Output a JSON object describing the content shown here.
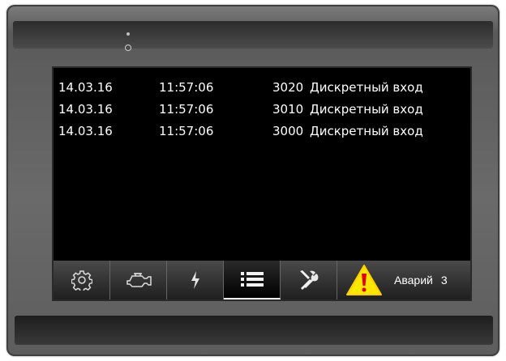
{
  "events": [
    {
      "date": "14.03.16",
      "time": "11:57:06",
      "code": "3020",
      "description": "Дискретный вход"
    },
    {
      "date": "14.03.16",
      "time": "11:57:06",
      "code": "3010",
      "description": "Дискретный вход"
    },
    {
      "date": "14.03.16",
      "time": "11:57:06",
      "code": "3000",
      "description": "Дискретный вход"
    }
  ],
  "navbar": {
    "items": [
      {
        "icon": "gear-icon"
      },
      {
        "icon": "engine-icon"
      },
      {
        "icon": "lightning-icon"
      },
      {
        "icon": "list-icon",
        "active": true
      },
      {
        "icon": "tools-icon"
      }
    ],
    "alarm": {
      "icon": "warning-icon",
      "label": "Аварий",
      "count": "3",
      "colors": {
        "warning_fill": "#ffe600",
        "warning_mark": "#e00000"
      }
    }
  }
}
